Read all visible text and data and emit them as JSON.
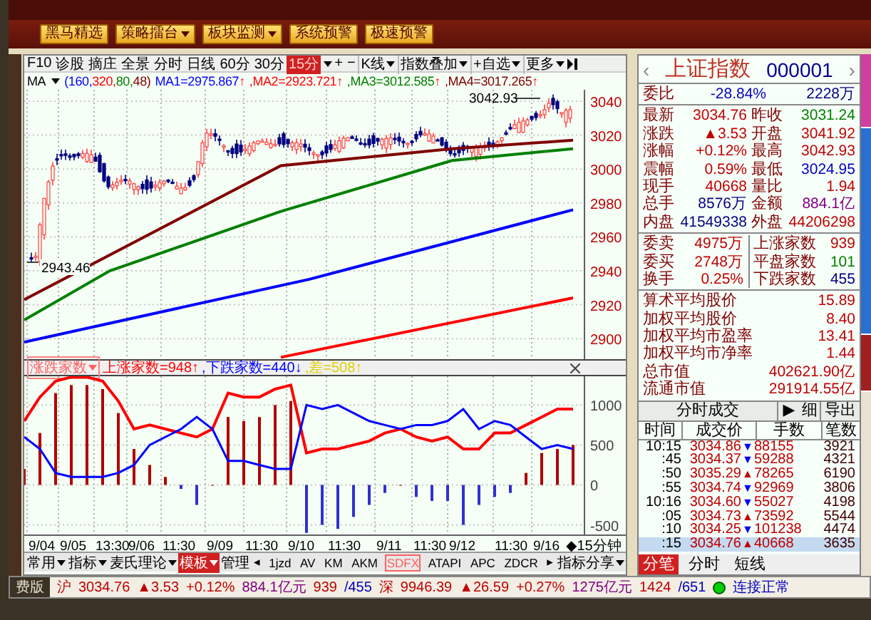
{
  "toolbar": {
    "buttons": [
      {
        "label": "黑马精选",
        "dropdown": false
      },
      {
        "label": "策略擂台",
        "dropdown": true
      },
      {
        "label": "板块监测",
        "dropdown": true
      },
      {
        "label": "系统预警",
        "dropdown": false
      },
      {
        "label": "极速预警",
        "dropdown": false
      }
    ]
  },
  "chart_toolbar": {
    "links": [
      "F10",
      "诊股",
      "摘庄",
      "全景"
    ],
    "periods": [
      {
        "label": "分时",
        "selected": false
      },
      {
        "label": "日线",
        "selected": false
      },
      {
        "label": "60分",
        "selected": false
      },
      {
        "label": "30分",
        "selected": false
      },
      {
        "label": "15分",
        "selected": true
      }
    ],
    "zoom": [
      "+",
      "−"
    ],
    "menus": [
      "K线",
      "指数叠加",
      "+自选",
      "更多"
    ]
  },
  "ma_bar": {
    "label": "MA",
    "params": [
      {
        "text": "(160,",
        "color": "#0000ff"
      },
      {
        "text": "320,",
        "color": "#ff0000"
      },
      {
        "text": "80,",
        "color": "#008000"
      },
      {
        "text": "48)",
        "color": "#800000"
      }
    ],
    "lines": [
      {
        "text": "MA1=2975.867",
        "arrow": "↑",
        "color": "#0000ff"
      },
      {
        "text": ",MA2=2923.721",
        "arrow": "↑",
        "color": "#ff0000"
      },
      {
        "text": ",MA3=3012.585",
        "arrow": "↑",
        "color": "#008000"
      },
      {
        "text": ",MA4=3017.265",
        "arrow": "↑",
        "color": "#800000"
      }
    ]
  },
  "price_chart": {
    "y_ticks": [
      "3040",
      "3020",
      "3000",
      "2980",
      "2960",
      "2940",
      "2920",
      "2900"
    ],
    "high_label": "3042.93",
    "low_label": "2943.46"
  },
  "indicator": {
    "name": "涨跌家数",
    "values": [
      {
        "text": "上涨家数=948",
        "arrow": "↑",
        "color": "#ff0000"
      },
      {
        "text": ",下跌家数=440",
        "arrow": "↓",
        "color": "#0000ff"
      },
      {
        "text": ",差=508",
        "arrow": "↑",
        "color": "#e0d000"
      }
    ],
    "chart_data": {
      "type": "line",
      "grid": true,
      "yticks": [
        1000,
        500,
        0,
        -500
      ],
      "ylim": [
        -620,
        1360
      ],
      "series": [
        {
          "color": "#ff0000",
          "values": [
            800,
            1100,
            1300,
            1350,
            1350,
            1300,
            1050,
            700,
            750,
            700,
            650,
            600,
            700,
            1150,
            1100,
            1100,
            1200,
            1250,
            400,
            450,
            450,
            500,
            550,
            650,
            700,
            600,
            550,
            600,
            450,
            450,
            650,
            650,
            750,
            850,
            950,
            950
          ]
        },
        {
          "color": "#0000ff",
          "values": [
            600,
            450,
            150,
            100,
            100,
            100,
            150,
            250,
            500,
            600,
            700,
            850,
            700,
            300,
            300,
            250,
            200,
            200,
            1000,
            950,
            1000,
            900,
            800,
            750,
            700,
            750,
            750,
            800,
            950,
            700,
            800,
            750,
            600,
            450,
            500,
            450
          ]
        },
        {
          "type": "bar",
          "color": "#b00000",
          "values": [
            200,
            650,
            1150,
            1250,
            1250,
            1200,
            900,
            450,
            250,
            100,
            null,
            null,
            0,
            850,
            800,
            850,
            1000,
            1050,
            null,
            null,
            null,
            null,
            null,
            null,
            0,
            null,
            null,
            null,
            null,
            null,
            null,
            null,
            150,
            400,
            450,
            500
          ]
        },
        {
          "type": "bar",
          "color": "#3030d0",
          "values": [
            null,
            null,
            null,
            null,
            null,
            null,
            null,
            null,
            null,
            null,
            -50,
            -250,
            null,
            null,
            null,
            null,
            null,
            null,
            -600,
            -500,
            -550,
            -400,
            -250,
            -100,
            null,
            -150,
            -200,
            -200,
            -500,
            -250,
            -150,
            -100,
            null,
            null,
            null,
            null
          ]
        }
      ]
    }
  },
  "x_axis": {
    "labels": [
      "9/04",
      "9/05",
      "13:30",
      "9/06",
      "11:30",
      "9/09",
      "11:30",
      "9/10",
      "11:30",
      "9/11",
      "11:30",
      "9/12",
      "11:30",
      "9/16"
    ],
    "period": "◆15分钟"
  },
  "bottom_tabs": {
    "menus": [
      {
        "label": "常用",
        "selected": false
      },
      {
        "label": "指标",
        "selected": false
      },
      {
        "label": "麦氏理论",
        "selected": false
      },
      {
        "label": "模板",
        "selected": true
      }
    ],
    "manage": "管理",
    "prev": "◂",
    "next": "▸",
    "indicators": [
      {
        "label": "1jzd",
        "selected": false
      },
      {
        "label": "AV",
        "selected": false
      },
      {
        "label": "KM",
        "selected": false
      },
      {
        "label": "AKM",
        "selected": false
      },
      {
        "label": "SDFX",
        "selected": true
      },
      {
        "label": "ATAPI",
        "selected": false
      },
      {
        "label": "APC",
        "selected": false
      },
      {
        "label": "ZDCR",
        "selected": false
      }
    ],
    "share": "指标分享"
  },
  "quote": {
    "prev": "‹",
    "name": "上证指数",
    "code": "000001",
    "next": "›",
    "weibi": {
      "label": "委比",
      "value": {
        "text": "-28.84%",
        "color": "#0000c0"
      },
      "amount": {
        "text": "2228万",
        "color": "#000080"
      }
    },
    "stats": [
      [
        {
          "label": "最新",
          "value": "3034.76",
          "color": "#c00000"
        },
        {
          "label": "昨收",
          "value": "3031.24",
          "color": "#008000"
        }
      ],
      [
        {
          "label": "涨跌",
          "value": "▲3.53",
          "color": "#c00000"
        },
        {
          "label": "开盘",
          "value": "3041.92",
          "color": "#c00000"
        }
      ],
      [
        {
          "label": "涨幅",
          "value": "+0.12%",
          "color": "#c00000"
        },
        {
          "label": "最高",
          "value": "3042.93",
          "color": "#c00000"
        }
      ],
      [
        {
          "label": "震幅",
          "value": "0.59%",
          "color": "#c00000"
        },
        {
          "label": "最低",
          "value": "3024.95",
          "color": "#0000c0"
        }
      ],
      [
        {
          "label": "现手",
          "value": "40668",
          "color": "#c00000"
        },
        {
          "label": "量比",
          "value": "1.94",
          "color": "#c00000"
        }
      ],
      [
        {
          "label": "总手",
          "value": "8576万",
          "color": "#000080"
        },
        {
          "label": "金额",
          "value": "884.1亿",
          "color": "#800080"
        }
      ],
      [
        {
          "label": "内盘",
          "value": "41549338",
          "color": "#000080"
        },
        {
          "label": "外盘",
          "value": "44206298",
          "color": "#c00000"
        }
      ]
    ],
    "orders": [
      [
        {
          "label": "委卖",
          "value": "4975万",
          "color": "#c00000"
        },
        {
          "label": "上涨家数",
          "value": "939",
          "color": "#c00000"
        }
      ],
      [
        {
          "label": "委买",
          "value": "2748万",
          "color": "#c00000"
        },
        {
          "label": "平盘家数",
          "value": "101",
          "color": "#008000"
        }
      ],
      [
        {
          "label": "换手",
          "value": "0.25%",
          "color": "#c00000"
        },
        {
          "label": "下跌家数",
          "value": "455",
          "color": "#000080"
        }
      ]
    ],
    "averages": [
      {
        "label": "算术平均股价",
        "value": "15.89"
      },
      {
        "label": "加权平均股价",
        "value": "8.40"
      },
      {
        "label": "加权平均市盈率",
        "value": "13.41"
      },
      {
        "label": "加权平均市净率",
        "value": "1.44"
      },
      {
        "label": "总市值",
        "value": "402621.90亿"
      },
      {
        "label": "流通市值",
        "value": "291914.55亿"
      }
    ]
  },
  "trades": {
    "title": "分时成交",
    "play": "▶",
    "detail": "细",
    "export": "导出",
    "columns": [
      "时间",
      "成交价",
      "手数",
      "笔数"
    ],
    "rows": [
      {
        "time": "10:15",
        "price": "3034.86",
        "arrow": {
          "symbol": "▼",
          "color": "#0000ff"
        },
        "volume": "88155",
        "count": "3921",
        "selected": false
      },
      {
        "time": ":45",
        "price": "3034.37",
        "arrow": {
          "symbol": "▼",
          "color": "#0000ff"
        },
        "volume": "59288",
        "count": "4321",
        "selected": false
      },
      {
        "time": ":50",
        "price": "3035.29",
        "arrow": {
          "symbol": "▲",
          "color": "#c00000"
        },
        "volume": "78265",
        "count": "6190",
        "selected": false
      },
      {
        "time": ":55",
        "price": "3034.74",
        "arrow": {
          "symbol": "▼",
          "color": "#0000ff"
        },
        "volume": "92969",
        "count": "3806",
        "selected": false
      },
      {
        "time": "10:16",
        "price": "3034.60",
        "arrow": {
          "symbol": "▼",
          "color": "#0000ff"
        },
        "volume": "55027",
        "count": "4198",
        "selected": false
      },
      {
        "time": ":05",
        "price": "3034.73",
        "arrow": {
          "symbol": "▲",
          "color": "#c00000"
        },
        "volume": "73592",
        "count": "5544",
        "selected": false
      },
      {
        "time": ":10",
        "price": "3034.25",
        "arrow": {
          "symbol": "▼",
          "color": "#0000ff"
        },
        "volume": "101238",
        "count": "4474",
        "selected": false
      },
      {
        "time": ":15",
        "price": "3034.76",
        "arrow": {
          "symbol": "▲",
          "color": "#c00000"
        },
        "volume": "40668",
        "count": "3635",
        "selected": true
      }
    ],
    "tabs": [
      {
        "label": "分笔",
        "selected": true
      },
      {
        "label": "分时",
        "selected": false
      },
      {
        "label": "短线",
        "selected": false
      }
    ]
  },
  "status_bar": {
    "edition": "费版",
    "items": [
      {
        "text": "沪",
        "color": "#c00000"
      },
      {
        "text": "3034.76",
        "color": "#c00000"
      },
      {
        "text": "▲3.53",
        "color": "#c00000"
      },
      {
        "text": "+0.12%",
        "color": "#c00000"
      },
      {
        "text": "884.1亿元",
        "color": "#800080"
      },
      {
        "text": "939",
        "color": "#c00000"
      },
      {
        "text": "/455",
        "color": "#0000c0"
      },
      {
        "text": "深",
        "color": "#c00000"
      },
      {
        "text": "9946.39",
        "color": "#c00000"
      },
      {
        "text": "▲26.59",
        "color": "#c00000"
      },
      {
        "text": "+0.27%",
        "color": "#c00000"
      },
      {
        "text": "1275亿元",
        "color": "#800080"
      },
      {
        "text": "1424",
        "color": "#c00000"
      },
      {
        "text": "/651",
        "color": "#0000c0"
      }
    ],
    "connection": {
      "text": "连接正常",
      "online": true
    }
  }
}
